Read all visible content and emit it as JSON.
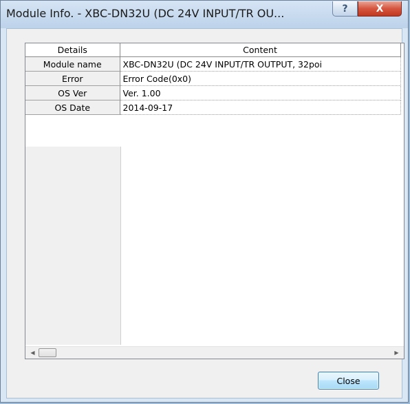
{
  "window": {
    "title": "Module Info. - XBC-DN32U (DC 24V INPUT/TR OU...",
    "help_glyph": "?",
    "close_glyph": "X"
  },
  "table": {
    "headers": [
      "Details",
      "Content"
    ],
    "rows": [
      {
        "key": "Module name",
        "value": "XBC-DN32U (DC 24V INPUT/TR OUTPUT, 32poi"
      },
      {
        "key": "Error",
        "value": "Error Code(0x0)"
      },
      {
        "key": "OS Ver",
        "value": "Ver. 1.00"
      },
      {
        "key": "OS Date",
        "value": "2014-09-17"
      }
    ]
  },
  "scrollbar": {
    "left_arrow": "◀",
    "right_arrow": "▶"
  },
  "buttons": {
    "close_label": "Close"
  }
}
